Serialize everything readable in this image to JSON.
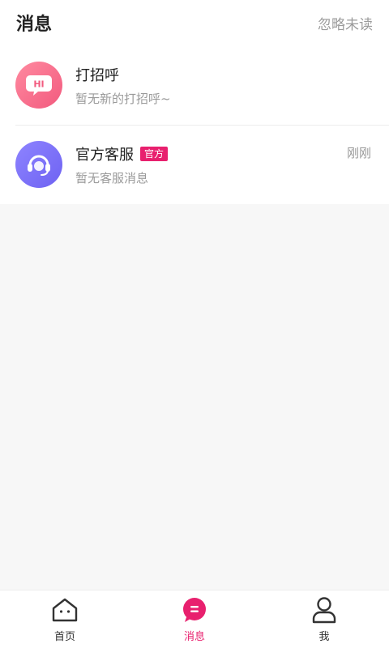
{
  "header": {
    "title": "消息",
    "ignore_unread": "忽略未读"
  },
  "conversations": [
    {
      "avatar_icon": "hi-icon",
      "avatar_text": "HI",
      "name": "打招呼",
      "preview": "暂无新的打招呼~",
      "time": "",
      "badge": ""
    },
    {
      "avatar_icon": "customer-service-headset-icon",
      "name": "官方客服",
      "badge": "官方",
      "preview": "暂无客服消息",
      "time": "刚刚"
    }
  ],
  "tabbar": {
    "items": [
      {
        "label": "首页",
        "icon": "home-icon",
        "active": false
      },
      {
        "label": "消息",
        "icon": "message-icon",
        "active": true
      },
      {
        "label": "我",
        "icon": "profile-icon",
        "active": false
      }
    ]
  },
  "colors": {
    "accent": "#e8206e",
    "hi_avatar": "#f25a7e",
    "cs_avatar": "#6e62f2"
  }
}
